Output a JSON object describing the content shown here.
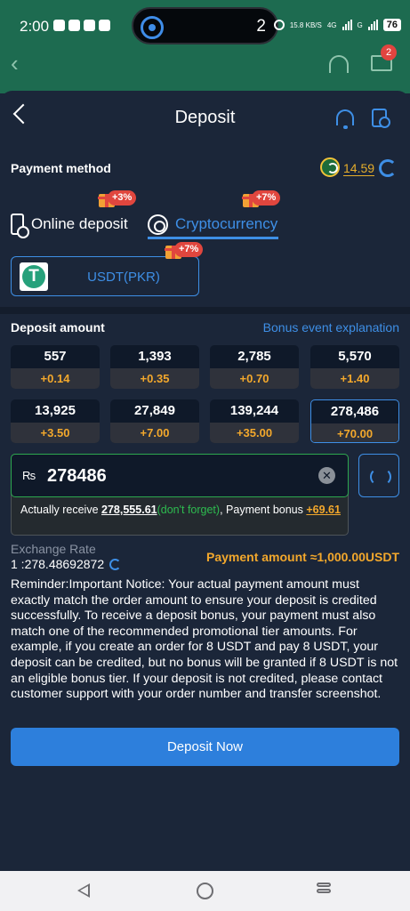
{
  "status_bar": {
    "time": "2:00",
    "media_number": "2",
    "net_speed": "15.8 KB/S",
    "net_type_1": "4G",
    "net_type_2": "G",
    "battery": "76"
  },
  "background_header": {
    "mail_badge": "2"
  },
  "header": {
    "title": "Deposit"
  },
  "payment_method": {
    "label": "Payment method",
    "balance": "14.59"
  },
  "tabs": [
    {
      "label": "Online deposit",
      "bonus": "+3%"
    },
    {
      "label": "Cryptocurrency",
      "bonus": "+7%"
    }
  ],
  "channel": {
    "label": "USDT(PKR)",
    "bonus": "+7%"
  },
  "deposit_amount": {
    "label": "Deposit amount",
    "bonus_link": "Bonus event explanation",
    "options": [
      {
        "value": "557",
        "bonus": "+0.14"
      },
      {
        "value": "1,393",
        "bonus": "+0.35"
      },
      {
        "value": "2,785",
        "bonus": "+0.70"
      },
      {
        "value": "5,570",
        "bonus": "+1.40"
      },
      {
        "value": "13,925",
        "bonus": "+3.50"
      },
      {
        "value": "27,849",
        "bonus": "+7.00"
      },
      {
        "value": "139,244",
        "bonus": "+35.00"
      },
      {
        "value": "278,486",
        "bonus": "+70.00"
      }
    ],
    "selected_index": 7
  },
  "amount_input": {
    "currency_symbol": "₨",
    "value": "278486",
    "receive_prefix": "Actually receive",
    "receive_amount": "278,555.61",
    "receive_reminder": "(don't forget)",
    "bonus_prefix": ", Payment bonus",
    "bonus_amount": "+69.61"
  },
  "exchange": {
    "label": "Exchange Rate",
    "value": "1 :278.48692872",
    "payment_amount": "Payment amount ≈1,000.00USDT"
  },
  "notice": "Reminder:Important Notice: Your actual payment amount must exactly match the order amount to ensure your deposit is credited successfully. To receive a deposit bonus, your payment must also match one of the recommended promotional tier amounts. For example, if you create an order for 8 USDT and pay 8 USDT, your deposit can be credited, but no bonus will be granted if 8 USDT is not an eligible bonus tier. If your deposit is not credited, please contact customer support with your order number and transfer screenshot.",
  "deposit_button": "Deposit Now",
  "colors": {
    "accent": "#3e8fe6",
    "bonus": "#f3a82c",
    "success": "#2dbc4f",
    "background": "#1b2639"
  }
}
